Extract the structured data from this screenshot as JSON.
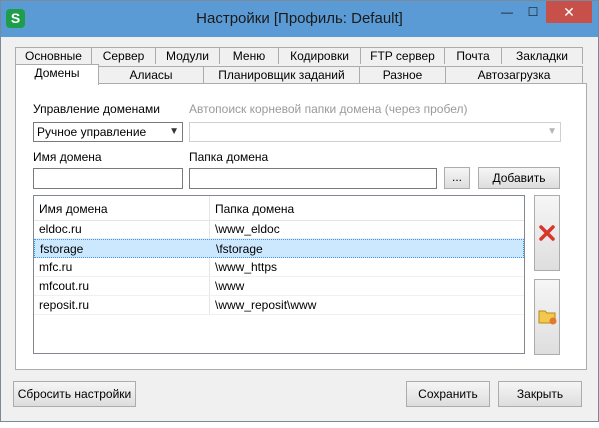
{
  "window": {
    "app_icon": "S",
    "title": "Настройки [Профиль: Default]",
    "minimize_glyph": "—",
    "maximize_glyph": "☐",
    "close_glyph": "✕"
  },
  "tabs_row1": [
    "Основные",
    "Сервер",
    "Модули",
    "Меню",
    "Кодировки",
    "FTP сервер",
    "Почта",
    "Закладки"
  ],
  "tabs_row2": [
    "Домены",
    "Алиасы",
    "Планировщик заданий",
    "Разное",
    "Автозагрузка"
  ],
  "active_tab": "Домены",
  "domains": {
    "management_label": "Управление доменами",
    "management_value": "Ручное управление",
    "autosearch_label": "Автопоиск корневой папки домена (через пробел)",
    "autosearch_value": "",
    "domain_name_label": "Имя домена",
    "domain_name_value": "",
    "domain_folder_label": "Папка домена",
    "domain_folder_value": "",
    "browse_label": "...",
    "add_label": "Добавить",
    "table": {
      "columns": [
        "Имя домена",
        "Папка домена"
      ],
      "rows": [
        {
          "name": "eldoc.ru",
          "folder": "\\www_eldoc"
        },
        {
          "name": "fstorage",
          "folder": "\\fstorage"
        },
        {
          "name": "mfc.ru",
          "folder": "\\www_https"
        },
        {
          "name": "mfcout.ru",
          "folder": "\\www"
        },
        {
          "name": "reposit.ru",
          "folder": "\\www_reposit\\www"
        }
      ],
      "selected_row": 1
    },
    "delete_icon": "red-x-icon",
    "folder_icon": "folder-arrow-icon"
  },
  "footer": {
    "reset_label": "Сбросить настройки",
    "save_label": "Сохранить",
    "close_label": "Закрыть"
  }
}
